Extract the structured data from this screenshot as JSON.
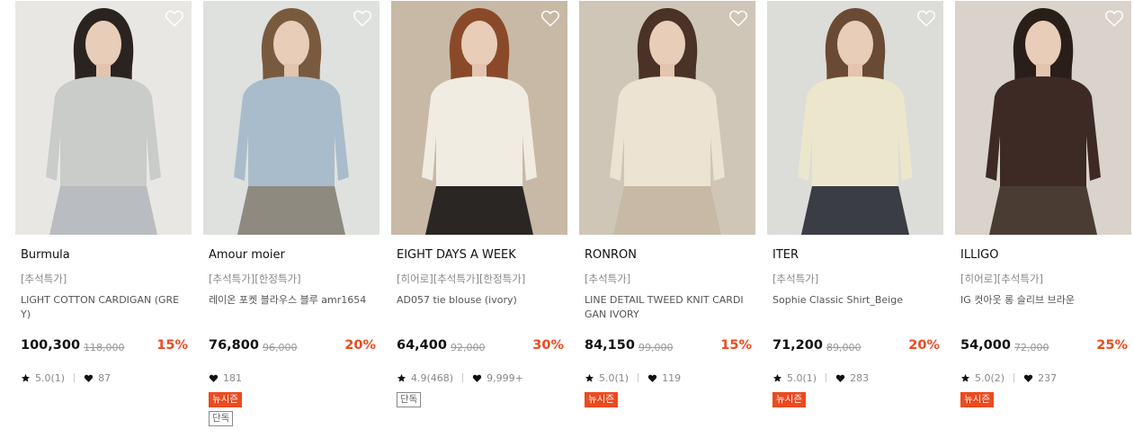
{
  "products": [
    {
      "brand": "Burmula",
      "tags": "[추석특가]",
      "name": "LIGHT COTTON CARDIGAN (GREY)",
      "price": "100,300",
      "original_price": "118,000",
      "discount": "15%",
      "rating": "5.0(1)",
      "likes": "87",
      "badges": [],
      "image_icon": "model-photo-grey-cardigan",
      "colors": {
        "bg": "#e9e7e3",
        "top": "#c9ccc8",
        "bottom": "#b9bcc0",
        "hair": "#2a2420"
      }
    },
    {
      "brand": "Amour moier",
      "tags": "[추석특가][한정특가]",
      "name": "레이온 포켓 블라우스 블루 amr1654",
      "price": "76,800",
      "original_price": "96,000",
      "discount": "20%",
      "rating": "",
      "likes": "181",
      "badges": [
        {
          "type": "new",
          "label": "뉴시즌"
        },
        {
          "type": "excl",
          "label": "단독"
        }
      ],
      "image_icon": "model-photo-blue-blouse",
      "colors": {
        "bg": "#dfe1df",
        "top": "#a9bccb",
        "bottom": "#8f8a80",
        "hair": "#7a5a3e"
      }
    },
    {
      "brand": "EIGHT DAYS A WEEK",
      "tags": "[히어로][추석특가][한정특가]",
      "name": "AD057 tie blouse (ivory)",
      "price": "64,400",
      "original_price": "92,000",
      "discount": "30%",
      "rating": "4.9(468)",
      "likes": "9,999+",
      "badges": [
        {
          "type": "excl",
          "label": "단독"
        }
      ],
      "image_icon": "model-photo-ivory-tie-blouse",
      "colors": {
        "bg": "#c8b9a6",
        "top": "#f1ece2",
        "bottom": "#2a2624",
        "hair": "#8a4a2a"
      }
    },
    {
      "brand": "RONRON",
      "tags": "[추석특가]",
      "name": "LINE DETAIL TWEED KNIT CARDIGAN IVORY",
      "price": "84,150",
      "original_price": "99,000",
      "discount": "15%",
      "rating": "5.0(1)",
      "likes": "119",
      "badges": [
        {
          "type": "new",
          "label": "뉴시즌"
        }
      ],
      "image_icon": "model-photo-tweed-cardigan",
      "colors": {
        "bg": "#cfc6b8",
        "top": "#ece3d3",
        "bottom": "#c7b9a5",
        "hair": "#4a3226"
      }
    },
    {
      "brand": "ITER",
      "tags": "[추석특가]",
      "name": "Sophie Classic Shirt_Beige",
      "price": "71,200",
      "original_price": "89,000",
      "discount": "20%",
      "rating": "5.0(1)",
      "likes": "283",
      "badges": [
        {
          "type": "new",
          "label": "뉴시즌"
        }
      ],
      "image_icon": "model-photo-beige-shirt",
      "colors": {
        "bg": "#dcdcd9",
        "top": "#ece7cc",
        "bottom": "#3a3d44",
        "hair": "#6a4a34"
      }
    },
    {
      "brand": "ILLIGO",
      "tags": "[히어로][추석특가]",
      "name": "IG 컷아웃 롱 슬리브 브라운",
      "price": "54,000",
      "original_price": "72,000",
      "discount": "25%",
      "rating": "5.0(2)",
      "likes": "237",
      "badges": [
        {
          "type": "new",
          "label": "뉴시즌"
        }
      ],
      "image_icon": "model-photo-brown-cutout-top",
      "colors": {
        "bg": "#d9d3cb",
        "top": "#3d2a24",
        "bottom": "#4a3c32",
        "hair": "#2a1e18"
      }
    }
  ]
}
